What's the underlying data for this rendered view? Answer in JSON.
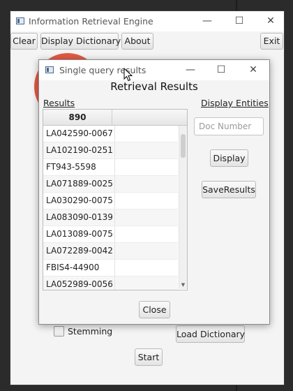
{
  "main_window": {
    "title": "Information Retrieval Engine",
    "toolbar": {
      "clear_label": "Clear",
      "display_dictionary_label": "Display Dictionary",
      "about_label": "About",
      "exit_label": "Exit"
    },
    "stemming_label": "Stemming",
    "stemming_checked": false,
    "load_dictionary_label": "Load Dictionary",
    "start_label": "Start",
    "window_controls": {
      "minimize": "—",
      "maximize": "☐",
      "close": "✕"
    }
  },
  "dialog": {
    "title": "Single query results",
    "heading": "Retrieval Results",
    "results_label": "Results",
    "display_entities_label": "Display Entities",
    "table": {
      "columns": [
        "890",
        ""
      ],
      "rows": [
        "LA042590-0067",
        "LA102190-0251",
        "FT943-5598",
        "LA071889-0025",
        "LA030290-0075",
        "LA083090-0139",
        "LA013089-0075",
        "LA072289-0042",
        "FBIS4-44900",
        "LA052989-0056"
      ]
    },
    "doc_number": {
      "value": "",
      "placeholder": "Doc Number"
    },
    "display_label": "Display",
    "save_results_label": "SaveResults",
    "close_label": "Close",
    "window_controls": {
      "minimize": "—",
      "maximize": "☐",
      "close": "✕"
    }
  },
  "colors": {
    "logo_accent": "#e25a45",
    "desktop_bg": "#2b2b2b"
  }
}
